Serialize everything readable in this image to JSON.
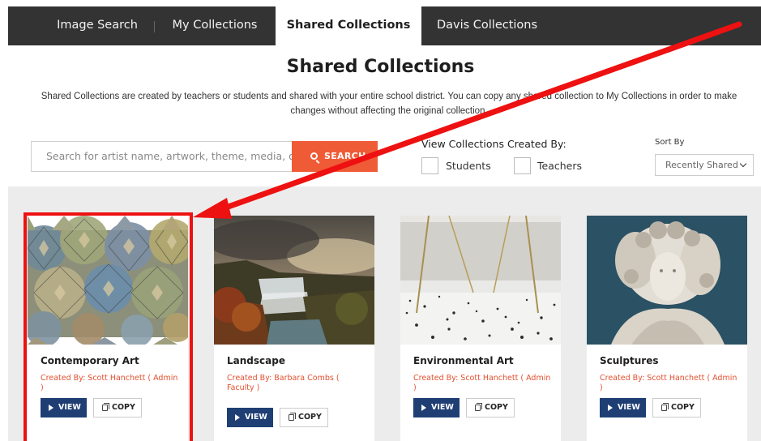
{
  "nav": {
    "tabs": [
      {
        "label": "Image Search"
      },
      {
        "label": "My Collections"
      },
      {
        "label": "Shared Collections"
      },
      {
        "label": "Davis Collections"
      }
    ],
    "active_index": 2
  },
  "page": {
    "title": "Shared Collections",
    "description": "Shared Collections are created by teachers or students and shared with your entire school district. You can copy any shared collection to My Collections in order to make changes without affecting the original collection."
  },
  "search": {
    "placeholder": "Search for artist name, artwork, theme, media, o",
    "button_label": "SEARCH",
    "icon": "search-icon"
  },
  "filter": {
    "title": "View Collections Created By:",
    "options": [
      {
        "label": "Students",
        "checked": false
      },
      {
        "label": "Teachers",
        "checked": false
      }
    ]
  },
  "sort": {
    "label": "Sort By",
    "selected": "Recently Shared"
  },
  "collections": [
    {
      "title": "Contemporary Art",
      "created_by": "Created By: Scott Hanchett ( Admin )",
      "view_label": "VIEW",
      "copy_label": "COPY",
      "image": "kaleidoscope-pattern"
    },
    {
      "title": "Landscape",
      "created_by": "Created By: Barbara Combs ( Faculty )",
      "view_label": "VIEW",
      "copy_label": "COPY",
      "image": "waterfall-landscape-painting"
    },
    {
      "title": "Environmental Art",
      "created_by": "Created By: Scott Hanchett ( Admin )",
      "view_label": "VIEW",
      "copy_label": "COPY",
      "image": "terrazzo-room-installation"
    },
    {
      "title": "Sculptures",
      "created_by": "Created By: Scott Hanchett ( Admin )",
      "view_label": "VIEW",
      "copy_label": "COPY",
      "image": "marble-bust-sculpture"
    }
  ],
  "colors": {
    "nav_bg": "#333333",
    "accent_orange": "#ef5b36",
    "view_button": "#1f3f74",
    "creator_text": "#e2502f",
    "annotation_red": "#ee1111"
  }
}
